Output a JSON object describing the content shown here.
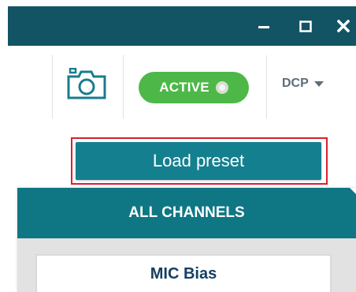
{
  "window_controls": {
    "minimize": "–",
    "maximize": "☐",
    "close": "✕"
  },
  "toolbar": {
    "camera_icon": "camera-icon",
    "status_badge": "ACTIVE",
    "status_indicator_icon": "dot-icon",
    "dcp_label": "DCP",
    "dcp_icon": "caret-down-icon"
  },
  "actions": {
    "load_preset_label": "Load preset"
  },
  "panel": {
    "header": "ALL CHANNELS",
    "items": [
      {
        "label": "MIC Bias"
      }
    ]
  },
  "colors": {
    "titlebar": "#135464",
    "active_badge": "#4db848",
    "button_teal": "#14808f",
    "panel_header": "#0f7684",
    "highlight": "#d92030"
  }
}
